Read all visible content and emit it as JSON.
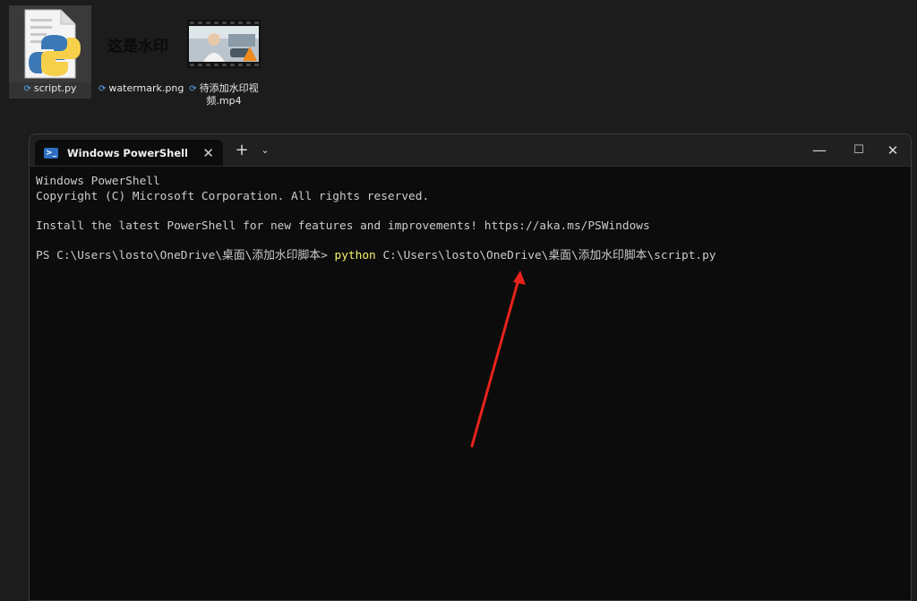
{
  "desktop": {
    "icons": [
      {
        "label": "script.py",
        "icon": "python-file-icon",
        "selected": true
      },
      {
        "label": "watermark.png",
        "icon": "image-file-icon",
        "thumbnail_text": "这是水印"
      },
      {
        "label": "待添加水印视频.mp4",
        "icon": "video-file-icon"
      }
    ],
    "sync_icon": "sync-icon",
    "sync_color": "#5aa7f0"
  },
  "window": {
    "tab_title": "Windows PowerShell",
    "tab_close": "✕",
    "new_tab": "+",
    "dropdown": "⌄",
    "minimize": "—",
    "maximize": "☐",
    "close": "✕",
    "console": {
      "line1": "Windows PowerShell",
      "line2": "Copyright (C) Microsoft Corporation. All rights reserved.",
      "line3": "Install the latest PowerShell for new features and improvements! https://aka.ms/PSWindows",
      "prompt": "PS C:\\Users\\losto\\OneDrive\\桌面\\添加水印脚本> ",
      "command": "python",
      "argument": " C:\\Users\\losto\\OneDrive\\桌面\\添加水印脚本\\script.py"
    }
  },
  "colors": {
    "console_bg": "#0c0c0c",
    "command_yellow": "#f2f26f",
    "arrow_red": "#e8231b"
  }
}
